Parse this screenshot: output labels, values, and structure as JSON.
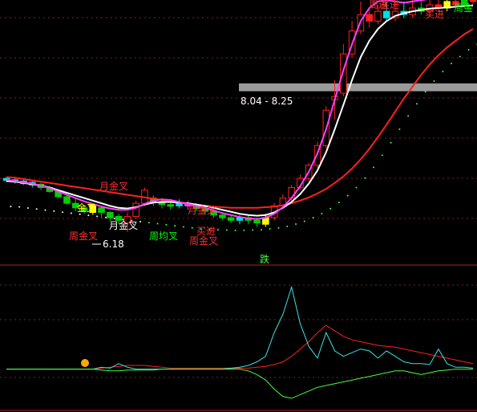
{
  "chart_data": [
    {
      "type": "line",
      "panel": "main",
      "note_scale": "relative price levels read from image (no axis printed)",
      "ylim": [
        5.8,
        9.6
      ],
      "candles": [
        {
          "o": 7.0,
          "c": 6.97,
          "h": 7.02,
          "l": 6.94,
          "color": "cyan"
        },
        {
          "o": 6.98,
          "c": 6.95,
          "h": 7.0,
          "l": 6.92,
          "color": "cyan"
        },
        {
          "o": 6.96,
          "c": 6.92,
          "h": 6.98,
          "l": 6.9,
          "color": "cyan"
        },
        {
          "o": 6.94,
          "c": 6.9,
          "h": 6.96,
          "l": 6.86,
          "color": "cyan"
        },
        {
          "o": 6.91,
          "c": 6.86,
          "h": 6.93,
          "l": 6.82,
          "color": "green"
        },
        {
          "o": 6.86,
          "c": 6.8,
          "h": 6.88,
          "l": 6.78,
          "color": "green"
        },
        {
          "o": 6.8,
          "c": 6.72,
          "h": 6.82,
          "l": 6.7,
          "color": "green"
        },
        {
          "o": 6.72,
          "c": 6.62,
          "h": 6.74,
          "l": 6.6,
          "color": "green"
        },
        {
          "o": 6.62,
          "c": 6.55,
          "h": 6.7,
          "l": 6.5,
          "color": "green"
        },
        {
          "o": 6.55,
          "c": 6.5,
          "h": 6.58,
          "l": 6.46,
          "color": "green"
        },
        {
          "o": 6.48,
          "c": 6.6,
          "h": 6.62,
          "l": 6.44,
          "color": "yellow"
        },
        {
          "o": 6.55,
          "c": 6.48,
          "h": 6.58,
          "l": 6.4,
          "color": "green"
        },
        {
          "o": 6.48,
          "c": 6.4,
          "h": 6.5,
          "l": 6.34,
          "color": "green"
        },
        {
          "o": 6.42,
          "c": 6.36,
          "h": 6.46,
          "l": 6.3,
          "color": "green"
        },
        {
          "o": 6.32,
          "c": 6.42,
          "h": 6.48,
          "l": 6.18,
          "color": "red"
        },
        {
          "o": 6.42,
          "c": 6.62,
          "h": 6.66,
          "l": 6.38,
          "color": "red"
        },
        {
          "o": 6.62,
          "c": 6.82,
          "h": 6.86,
          "l": 6.58,
          "color": "red"
        },
        {
          "o": 6.7,
          "c": 6.64,
          "h": 6.74,
          "l": 6.58,
          "color": "green"
        },
        {
          "o": 6.64,
          "c": 6.6,
          "h": 6.7,
          "l": 6.54,
          "color": "green"
        },
        {
          "o": 6.6,
          "c": 6.58,
          "h": 6.66,
          "l": 6.52,
          "color": "green"
        },
        {
          "o": 6.58,
          "c": 6.62,
          "h": 6.68,
          "l": 6.54,
          "color": "cyan"
        },
        {
          "o": 6.62,
          "c": 6.58,
          "h": 6.66,
          "l": 6.52,
          "color": "magenta"
        },
        {
          "o": 6.58,
          "c": 6.54,
          "h": 6.62,
          "l": 6.5,
          "color": "green"
        },
        {
          "o": 6.54,
          "c": 6.5,
          "h": 6.58,
          "l": 6.46,
          "color": "green"
        },
        {
          "o": 6.5,
          "c": 6.44,
          "h": 6.54,
          "l": 6.4,
          "color": "green"
        },
        {
          "o": 6.44,
          "c": 6.4,
          "h": 6.48,
          "l": 6.36,
          "color": "green"
        },
        {
          "o": 6.4,
          "c": 6.36,
          "h": 6.44,
          "l": 6.32,
          "color": "green"
        },
        {
          "o": 6.36,
          "c": 6.4,
          "h": 6.44,
          "l": 6.3,
          "color": "cyan"
        },
        {
          "o": 6.4,
          "c": 6.36,
          "h": 6.44,
          "l": 6.3,
          "color": "green"
        },
        {
          "o": 6.36,
          "c": 6.32,
          "h": 6.4,
          "l": 6.26,
          "color": "green"
        },
        {
          "o": 6.3,
          "c": 6.4,
          "h": 6.46,
          "l": 6.26,
          "color": "yellow"
        },
        {
          "o": 6.4,
          "c": 6.58,
          "h": 6.62,
          "l": 6.36,
          "color": "red"
        },
        {
          "o": 6.58,
          "c": 6.7,
          "h": 6.76,
          "l": 6.54,
          "color": "red"
        },
        {
          "o": 6.7,
          "c": 6.86,
          "h": 6.9,
          "l": 6.66,
          "color": "red"
        },
        {
          "o": 6.86,
          "c": 7.0,
          "h": 7.06,
          "l": 6.82,
          "color": "red"
        },
        {
          "o": 7.0,
          "c": 7.2,
          "h": 7.24,
          "l": 6.96,
          "color": "red"
        },
        {
          "o": 7.2,
          "c": 7.5,
          "h": 7.56,
          "l": 7.16,
          "color": "red"
        },
        {
          "o": 7.5,
          "c": 8.04,
          "h": 8.1,
          "l": 7.46,
          "color": "red"
        },
        {
          "o": 8.2,
          "c": 8.25,
          "h": 8.5,
          "l": 7.9,
          "color": "red"
        },
        {
          "o": 8.3,
          "c": 8.9,
          "h": 9.05,
          "l": 8.25,
          "color": "red"
        },
        {
          "o": 8.9,
          "c": 9.25,
          "h": 9.4,
          "l": 8.85,
          "color": "red"
        },
        {
          "o": 9.25,
          "c": 9.5,
          "h": 9.7,
          "l": 9.2,
          "color": "red"
        },
        {
          "o": 9.5,
          "c": 9.4,
          "h": 9.6,
          "l": 9.3,
          "color": "red"
        },
        {
          "o": 9.4,
          "c": 9.55,
          "h": 9.65,
          "l": 9.35,
          "color": "red"
        },
        {
          "o": 9.55,
          "c": 9.45,
          "h": 9.7,
          "l": 9.4,
          "color": "cyan"
        },
        {
          "o": 9.45,
          "c": 9.55,
          "h": 9.7,
          "l": 9.4,
          "color": "red"
        },
        {
          "o": 9.55,
          "c": 9.5,
          "h": 9.7,
          "l": 9.45,
          "color": "cyan"
        },
        {
          "o": 9.5,
          "c": 9.6,
          "h": 9.75,
          "l": 9.45,
          "color": "red"
        },
        {
          "o": 9.6,
          "c": 9.55,
          "h": 9.75,
          "l": 9.5,
          "color": "green"
        },
        {
          "o": 9.55,
          "c": 9.65,
          "h": 9.8,
          "l": 9.5,
          "color": "red"
        },
        {
          "o": 9.65,
          "c": 9.6,
          "h": 9.8,
          "l": 9.55,
          "color": "red"
        },
        {
          "o": 9.6,
          "c": 9.7,
          "h": 9.85,
          "l": 9.55,
          "color": "yellow"
        },
        {
          "o": 9.7,
          "c": 9.65,
          "h": 9.85,
          "l": 9.6,
          "color": "red"
        },
        {
          "o": 9.65,
          "c": 9.75,
          "h": 9.9,
          "l": 9.6,
          "color": "green"
        },
        {
          "o": 9.75,
          "c": 9.7,
          "h": 9.9,
          "l": 9.65,
          "color": "red"
        }
      ],
      "lines": [
        {
          "color": "#ff2020",
          "values": [
            7.02,
            7.01,
            6.99,
            6.97,
            6.95,
            6.93,
            6.91,
            6.89,
            6.87,
            6.85,
            6.83,
            6.81,
            6.79,
            6.77,
            6.75,
            6.73,
            6.71,
            6.69,
            6.67,
            6.65,
            6.63,
            6.61,
            6.59,
            6.58,
            6.57,
            6.56,
            6.55,
            6.55,
            6.55,
            6.55,
            6.56,
            6.57,
            6.59,
            6.62,
            6.66,
            6.71,
            6.77,
            6.84,
            6.93,
            7.03,
            7.15,
            7.29,
            7.45,
            7.63,
            7.82,
            8.02,
            8.22,
            8.4,
            8.58,
            8.74,
            8.88,
            9.0,
            9.1,
            9.2,
            9.28
          ]
        },
        {
          "color": "#ffffff",
          "values": [
            6.96,
            6.95,
            6.93,
            6.91,
            6.89,
            6.86,
            6.82,
            6.78,
            6.74,
            6.7,
            6.66,
            6.62,
            6.58,
            6.55,
            6.54,
            6.56,
            6.6,
            6.63,
            6.64,
            6.64,
            6.63,
            6.62,
            6.6,
            6.58,
            6.55,
            6.52,
            6.49,
            6.46,
            6.44,
            6.43,
            6.44,
            6.48,
            6.55,
            6.64,
            6.76,
            6.92,
            7.12,
            7.4,
            7.75,
            8.12,
            8.5,
            8.85,
            9.1,
            9.28,
            9.4,
            9.48,
            9.52,
            9.55,
            9.57,
            9.59,
            9.6,
            9.61,
            9.62,
            9.63,
            9.64
          ]
        },
        {
          "color": "#ff40ff",
          "values": [
            6.98,
            6.96,
            6.94,
            6.92,
            6.89,
            6.85,
            6.8,
            6.75,
            6.7,
            6.65,
            6.61,
            6.57,
            6.54,
            6.52,
            6.52,
            6.55,
            6.61,
            6.66,
            6.68,
            6.67,
            6.64,
            6.61,
            6.58,
            6.55,
            6.51,
            6.47,
            6.44,
            6.41,
            6.39,
            6.38,
            6.4,
            6.46,
            6.56,
            6.7,
            6.88,
            7.1,
            7.38,
            7.75,
            8.2,
            8.65,
            9.05,
            9.4,
            9.6,
            9.7,
            9.72,
            9.7,
            9.68,
            9.7,
            9.72,
            9.74,
            9.75,
            9.76,
            9.77,
            9.78,
            9.79
          ]
        }
      ],
      "highlight_box": {
        "y_from": 8.33,
        "y_to": 8.45
      },
      "annotations": [
        {
          "text": "8.04 - 8.25",
          "color": "#ffffff"
        },
        {
          "text": "6.18",
          "color": "#ffffff"
        },
        {
          "text": "月金叉",
          "color": "#ff3030"
        },
        {
          "text": "金叉",
          "color": "#ffff00"
        },
        {
          "text": "周金叉",
          "color": "#ff3030"
        },
        {
          "text": "月金叉",
          "color": "#ffffff"
        },
        {
          "text": "周均叉",
          "color": "#00ff00"
        },
        {
          "text": "买进",
          "color": "#ff3030"
        },
        {
          "text": "周金叉",
          "color": "#ff3030"
        },
        {
          "text": "月金叉",
          "color": "#ff3030"
        },
        {
          "text": "周进",
          "color": "#ff3030"
        },
        {
          "text": "买进",
          "color": "#ff3030"
        },
        {
          "text": "周金",
          "color": "#00ff00"
        },
        {
          "text": "买进",
          "color": "#ff3030"
        }
      ]
    },
    {
      "type": "line",
      "panel": "sub",
      "title": "跌",
      "ylim": [
        -40,
        100
      ],
      "series": [
        {
          "color": "#ff2020",
          "values": [
            0,
            0,
            0,
            0,
            0,
            0,
            0,
            0,
            0,
            0,
            0,
            1,
            2,
            3,
            4,
            4,
            4,
            3,
            2,
            1,
            1,
            1,
            1,
            1,
            1,
            1,
            1,
            1,
            1,
            2,
            3,
            5,
            8,
            14,
            22,
            30,
            40,
            48,
            42,
            36,
            32,
            30,
            28,
            26,
            25,
            24,
            22,
            20,
            18,
            16,
            14,
            12,
            10,
            8,
            6
          ]
        },
        {
          "color": "#40e0e0",
          "values": [
            0,
            0,
            0,
            0,
            0,
            0,
            0,
            0,
            0,
            0,
            0,
            2,
            1,
            6,
            2,
            0,
            0,
            0,
            0,
            0,
            0,
            0,
            0,
            0,
            0,
            0,
            1,
            2,
            4,
            8,
            14,
            40,
            60,
            90,
            50,
            25,
            12,
            40,
            20,
            14,
            18,
            22,
            20,
            12,
            20,
            14,
            8,
            6,
            6,
            5,
            22,
            6,
            2,
            2,
            1
          ]
        },
        {
          "color": "#40ff40",
          "values": [
            0,
            0,
            0,
            0,
            0,
            0,
            0,
            0,
            0,
            0,
            0,
            -1,
            -2,
            -2,
            -1,
            -1,
            -1,
            -1,
            0,
            0,
            0,
            0,
            0,
            0,
            0,
            0,
            0,
            0,
            -2,
            -6,
            -12,
            -22,
            -30,
            -32,
            -28,
            -24,
            -20,
            -18,
            -16,
            -14,
            -12,
            -10,
            -8,
            -6,
            -4,
            -2,
            -2,
            -4,
            -6,
            -4,
            -2,
            -1,
            0,
            0,
            0
          ]
        }
      ],
      "marker": {
        "shape": "circle",
        "color": "#ffaa00"
      }
    }
  ]
}
